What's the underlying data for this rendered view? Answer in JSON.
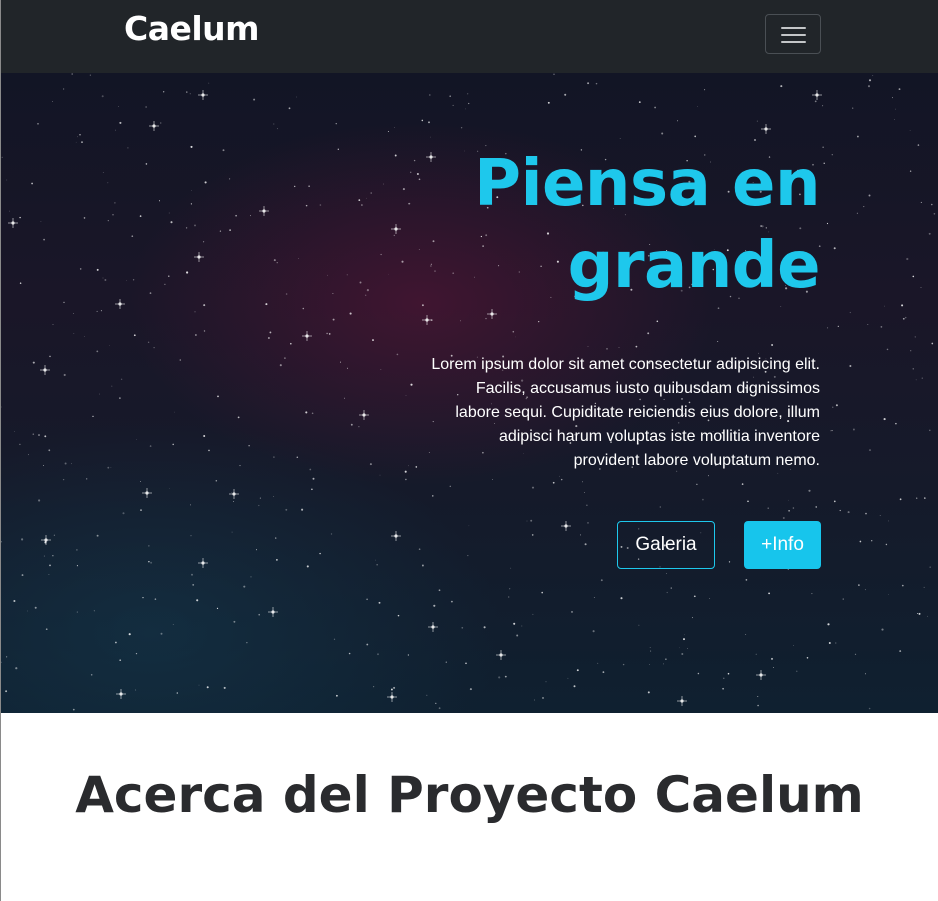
{
  "navbar": {
    "brand": "Caelum",
    "toggler_icon": "hamburger-menu-icon"
  },
  "hero": {
    "title": "Piensa en grande",
    "text": "Lorem ipsum dolor sit amet consectetur adipisicing elit. Facilis, accusamus iusto quibusdam dignissimos labore sequi. Cupiditate reiciendis eius dolore, illum adipisci harum voluptas iste mollitia inventore provident labore voluptatum nemo.",
    "buttons": {
      "galeria": "Galeria",
      "info": "+Info"
    }
  },
  "about": {
    "title": "Acerca del Proyecto Caelum"
  },
  "colors": {
    "navbar_bg": "#212529",
    "accent": "#17c5ec",
    "heading_dark": "#2a2b2e"
  }
}
